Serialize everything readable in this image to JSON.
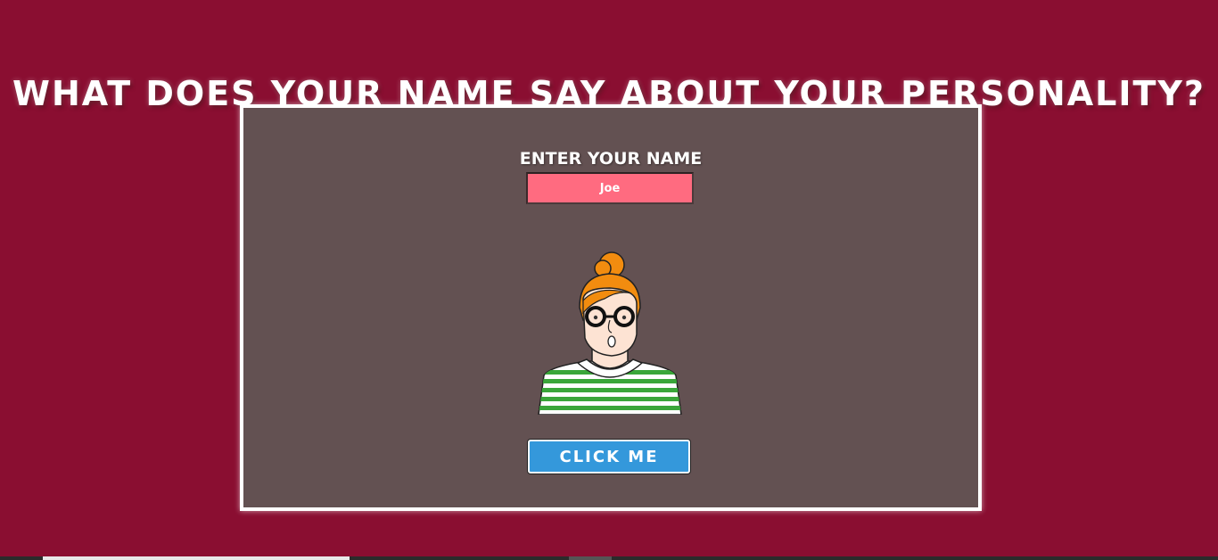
{
  "page": {
    "title": "What does your name say about your personality?"
  },
  "form": {
    "label": "Enter your name",
    "name_value": "Joe",
    "button_label": "Click me"
  },
  "avatar": {
    "icon": "cartoon-woman-avatar",
    "hair_color": "#f28c0f",
    "shirt_stripe_color": "#3aa63a"
  },
  "colors": {
    "background": "#8a0e31",
    "card": "#635152",
    "input": "#ff6b80",
    "button": "#3498db"
  }
}
